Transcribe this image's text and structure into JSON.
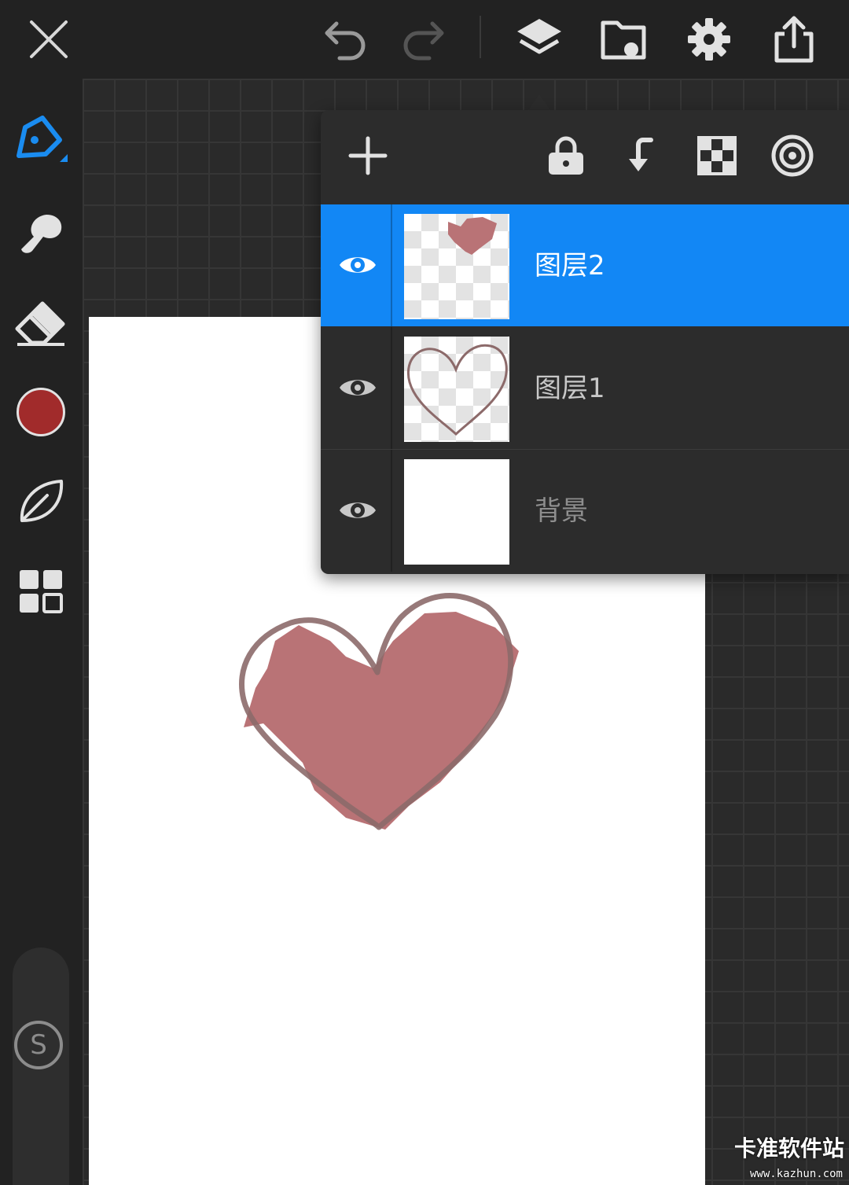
{
  "topbar": {
    "buttons": [
      "close-icon",
      "undo-icon",
      "redo-icon",
      "layers-icon",
      "gallery-icon",
      "settings-icon",
      "share-icon"
    ]
  },
  "sidebar": {
    "tools": [
      "pen-icon",
      "smudge-icon",
      "eraser-icon",
      "color-swatch",
      "leaf-brush-icon",
      "grid-menu-icon"
    ],
    "current_color": "#a12b2b",
    "accent": "#1287f5",
    "stabilizer_label": "S"
  },
  "layers_panel": {
    "toolbar": [
      "add-layer-icon",
      "lock-icon",
      "merge-down-icon",
      "transparency-lock-icon",
      "blend-mode-icon"
    ],
    "layers": [
      {
        "name": "图层2",
        "selected": true,
        "visible": true,
        "thumb": "heart-fill"
      },
      {
        "name": "图层1",
        "selected": false,
        "visible": true,
        "thumb": "heart-outline"
      },
      {
        "name": "背景",
        "selected": false,
        "visible": true,
        "thumb": "white"
      }
    ]
  },
  "canvas": {
    "fill_color": "#b97376",
    "stroke_color": "#8c6a6a"
  },
  "watermark": {
    "text": "卡准软件站",
    "url": "www.kazhun.com"
  }
}
